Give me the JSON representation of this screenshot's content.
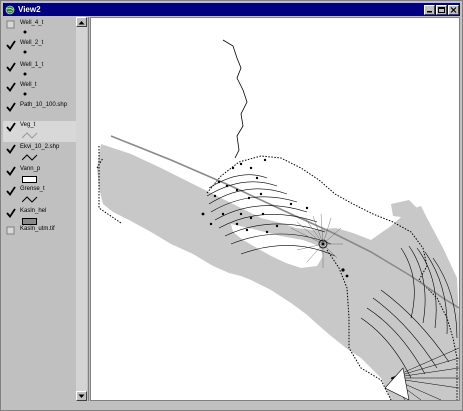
{
  "window": {
    "title": "View2"
  },
  "titlebar": {
    "buttons": [
      {
        "name": "minimize-button",
        "icon": "minimize-icon"
      },
      {
        "name": "maximize-button",
        "icon": "maximize-icon"
      },
      {
        "name": "close-button",
        "icon": "close-icon"
      }
    ]
  },
  "toc": {
    "layers": [
      {
        "label": "Well_4_t",
        "checked": false,
        "legend": "dot"
      },
      {
        "label": "Well_2_t",
        "checked": true,
        "legend": "dot"
      },
      {
        "label": "Well_1_t",
        "checked": true,
        "legend": "dot"
      },
      {
        "label": "Well_t",
        "checked": true,
        "legend": "dot"
      },
      {
        "label": "Path_10_100.shp",
        "checked": true,
        "legend": "none"
      },
      {
        "label": "Veg_t",
        "checked": true,
        "legend": "line-gray",
        "active": true
      },
      {
        "label": "Ekvi_10_2.shp",
        "checked": true,
        "legend": "line-black"
      },
      {
        "label": "Vann_p",
        "checked": true,
        "legend": "box-white"
      },
      {
        "label": "Grense_t",
        "checked": true,
        "legend": "line-black"
      },
      {
        "label": "Kasln_hel",
        "checked": true,
        "legend": "box-gray"
      },
      {
        "label": "Kasln_utm.tif",
        "checked": false,
        "legend": "none"
      }
    ]
  },
  "colors": {
    "titlebar": "#000080",
    "land": "#c8c8c8",
    "water": "#ffffff"
  }
}
